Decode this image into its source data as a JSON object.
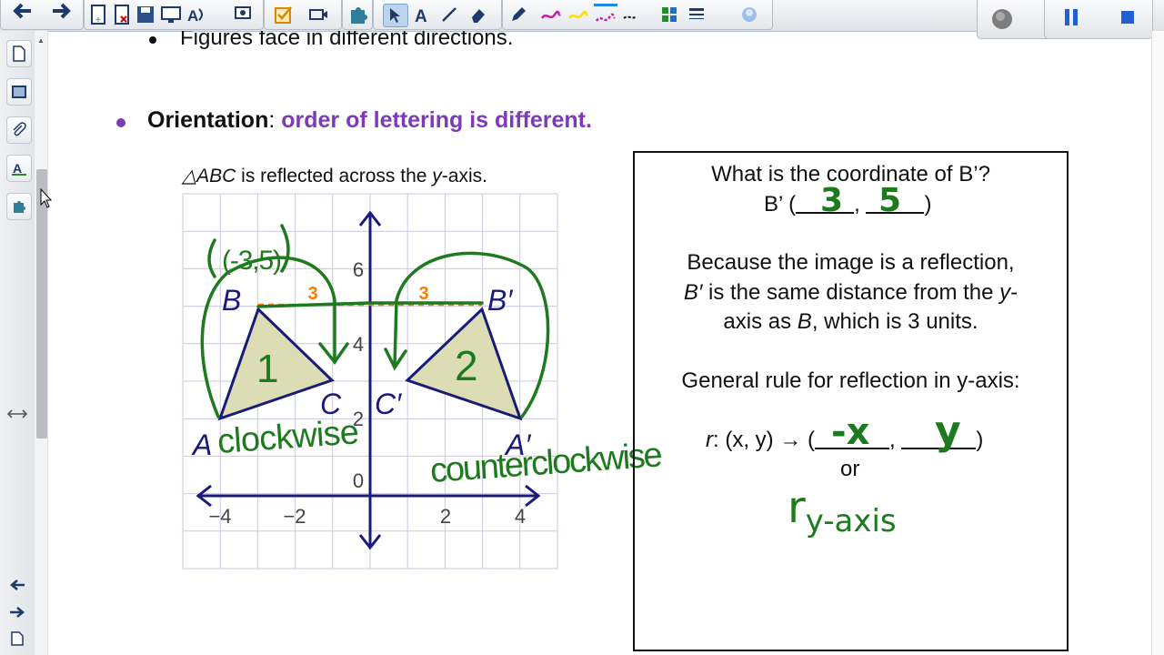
{
  "page_text": {
    "top_bullet": "Figures face in different directions.",
    "orientation_label": "Orientation",
    "orientation_colon": ":",
    "orientation_value": "order of lettering is different.",
    "caption_prefix": "△ABC",
    "caption_mid": " is reflected across the ",
    "caption_axis_var": "y",
    "caption_end": "-axis."
  },
  "graph": {
    "x_ticks": [
      "−4",
      "−2",
      "2",
      "4"
    ],
    "y_ticks": [
      "0",
      "2",
      "4",
      "6"
    ],
    "points": {
      "B": "B",
      "C": "C",
      "A": "A",
      "B_prime": "B′",
      "C_prime": "C′",
      "A_prime": "A′"
    },
    "distance_label_left": "3",
    "distance_label_right": "3",
    "handwriting": {
      "point_coords": "(-3,5)",
      "left_number": "1",
      "right_number": "2",
      "left_dir": "clockwise",
      "right_dir": "counterclockwise"
    }
  },
  "question_box": {
    "q_line1": "What is the coordinate of B’?",
    "q_line2_prefix": "B’ (",
    "q_line2_sep": ",",
    "q_line2_suffix": ")",
    "answer_x": "3",
    "answer_y": "5",
    "because_1": "Because the image is a reflection,",
    "because_2a": "B′",
    "because_2b": " is the same distance from the ",
    "because_2c": "y",
    "because_2d": "-",
    "because_3a": "axis as ",
    "because_3b": "B",
    "because_3c": ", which is 3 units.",
    "rule_title": "General rule for reflection in y-axis:",
    "rule_r": "r",
    "rule_body": ": (x, y) → (",
    "rule_sep": ",",
    "rule_end": ")",
    "rule_or": "or",
    "rule_answer_x": "-x",
    "rule_answer_y": "y",
    "rule_notation": "r",
    "rule_notation_sub": "y-axis"
  },
  "colors": {
    "accent_purple": "#7d3bb8",
    "handwriting_green": "#1e7a1e",
    "axis_navy": "#1a1a7a",
    "triangle_fill": "#ddddb5",
    "marker_orange": "#ff7a00"
  },
  "toolbar": {
    "icons": [
      "back-arrow-icon",
      "forward-arrow-icon",
      "new-page-icon",
      "delete-page-icon",
      "save-icon",
      "screen-shade-icon",
      "text-recognition-icon",
      "capture-icon",
      "check-icon",
      "video-icon",
      "puzzle-icon",
      "select-icon",
      "text-icon",
      "line-icon",
      "eraser-icon",
      "pen-icon",
      "magenta-pen-icon",
      "yellow-pen-icon",
      "blue-pen-icon",
      "black-pen-icon",
      "table-icon",
      "color-palette-icon",
      "fill-icon",
      "record-icon",
      "pause-icon",
      "stop-icon"
    ]
  }
}
